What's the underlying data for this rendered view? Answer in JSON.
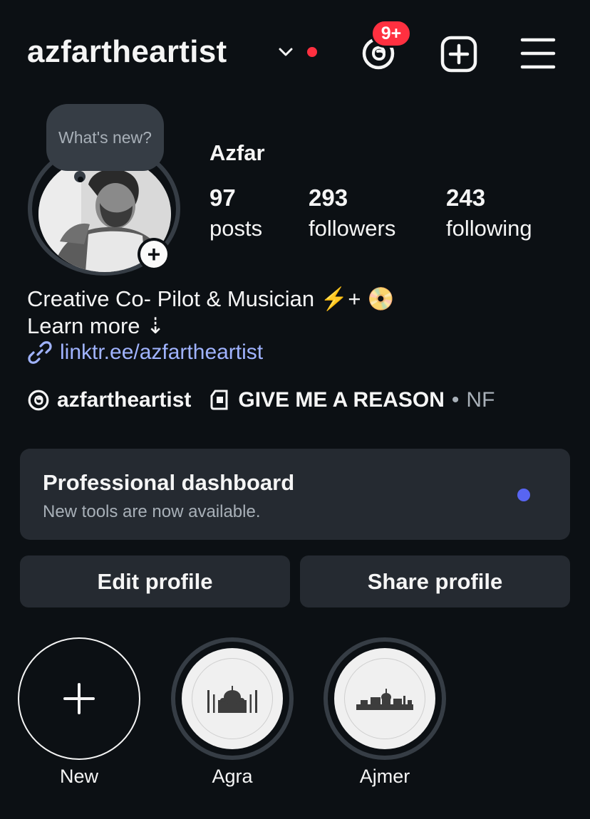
{
  "header": {
    "username": "azfartheartist",
    "notification_count": "9+"
  },
  "note": {
    "placeholder": "What's new?"
  },
  "profile": {
    "display_name": "Azfar",
    "stats": [
      {
        "value": "97",
        "label": "posts"
      },
      {
        "value": "293",
        "label": "followers"
      },
      {
        "value": "243",
        "label": "following"
      }
    ],
    "bio_lines": [
      "Creative Co- Pilot & Musician ⚡+ 📀",
      "Learn more ⇣"
    ],
    "link": "linktr.ee/azfartheartist",
    "threads_handle": "azfartheartist",
    "music": {
      "song": "GIVE ME A REASON",
      "separator": "•",
      "artist": "NF"
    }
  },
  "dashboard": {
    "title": "Professional dashboard",
    "subtitle": "New tools are now available."
  },
  "actions": {
    "edit_label": "Edit profile",
    "share_label": "Share profile"
  },
  "highlights": [
    {
      "label": "New"
    },
    {
      "label": "Agra"
    },
    {
      "label": "Ajmer"
    }
  ],
  "colors": {
    "background": "#0c1014",
    "card": "#252a31",
    "accent_red": "#ff3040",
    "link": "#a0b3ff",
    "dashboard_dot": "#5865f2"
  }
}
